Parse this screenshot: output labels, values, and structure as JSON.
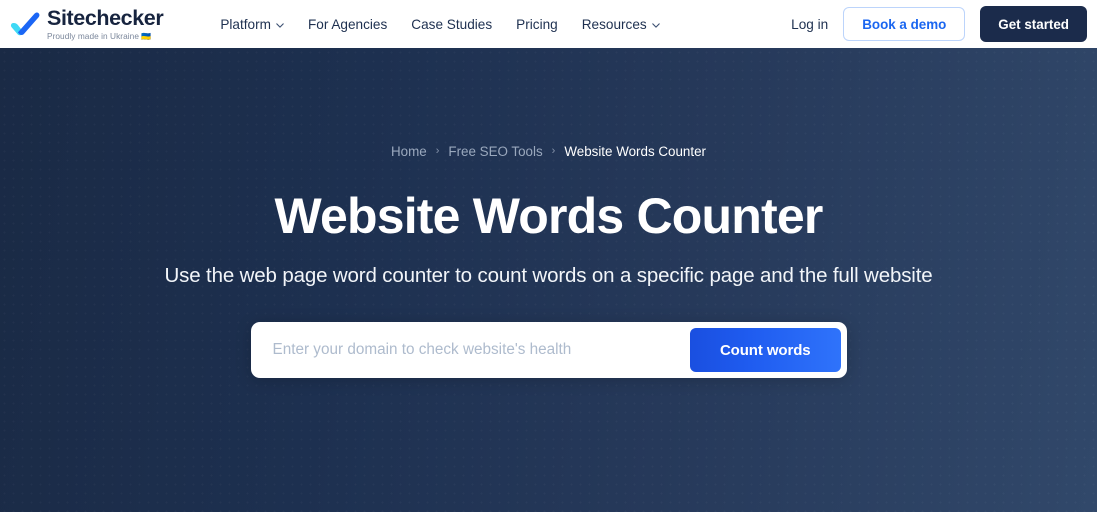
{
  "header": {
    "logo": {
      "name": "Sitechecker",
      "tagline": "Proudly made in Ukraine",
      "flag": "🇺🇦",
      "mark_color_light": "#3fd9f5",
      "mark_color_dark": "#1b66f5"
    },
    "nav": [
      {
        "label": "Platform",
        "has_dropdown": true
      },
      {
        "label": "For Agencies",
        "has_dropdown": false
      },
      {
        "label": "Case Studies",
        "has_dropdown": false
      },
      {
        "label": "Pricing",
        "has_dropdown": false
      },
      {
        "label": "Resources",
        "has_dropdown": true
      }
    ],
    "login_label": "Log in",
    "demo_label": "Book a demo",
    "get_started_label": "Get started"
  },
  "hero": {
    "breadcrumb": [
      {
        "label": "Home",
        "current": false
      },
      {
        "label": "Free SEO Tools",
        "current": false
      },
      {
        "label": "Website Words Counter",
        "current": true
      }
    ],
    "breadcrumb_separator": "›",
    "title": "Website Words Counter",
    "subtitle": "Use the web page word counter to count words on a specific page and the full website",
    "search": {
      "placeholder": "Enter your domain to check website's health",
      "value": "",
      "submit_label": "Count words"
    }
  },
  "colors": {
    "hero_bg_left": "#1a2a45",
    "hero_bg_right": "#31486a",
    "accent_blue": "#1a66f0",
    "dark_navy": "#1b2b4b",
    "cta_gradient_start": "#1a4fe0",
    "cta_gradient_end": "#2f73fb"
  }
}
